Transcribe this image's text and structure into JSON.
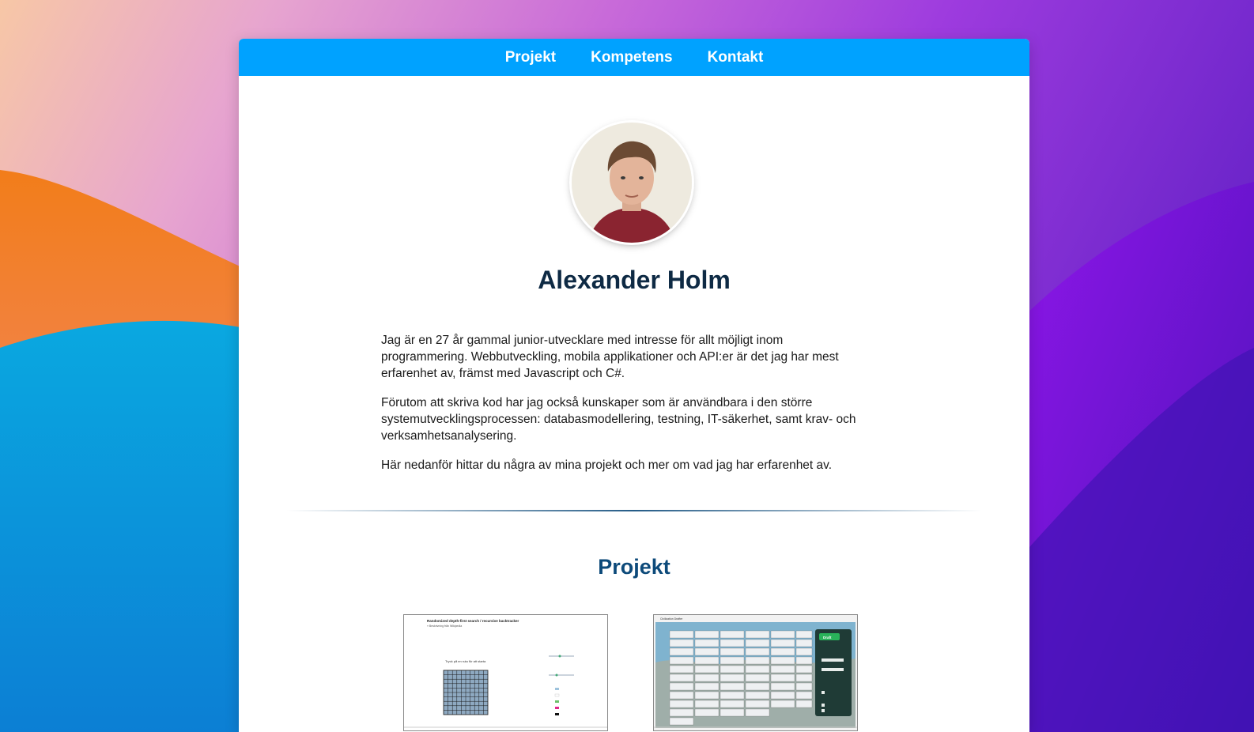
{
  "nav": {
    "items": [
      {
        "label": "Projekt"
      },
      {
        "label": "Kompetens"
      },
      {
        "label": "Kontakt"
      }
    ]
  },
  "profile": {
    "name": "Alexander Holm",
    "paragraphs": [
      "Jag är en 27 år gammal junior-utvecklare med intresse för allt möjligt inom programmering. Webbutveckling, mobila applikationer och API:er är det jag har mest erfarenhet av, främst med Javascript och C#.",
      "Förutom att skriva kod har jag också kunskaper som är användbara i den större systemutvecklingsprocessen: databasmodellering, testning, IT-säkerhet, samt krav- och verksamhetsanalysering.",
      "Här nedanför hittar du några av mina projekt och mer om vad jag har erfarenhet av."
    ]
  },
  "projects": {
    "title": "Projekt",
    "thumb1": {
      "title": "Randomized depth-first search / recursive backtracker",
      "subtitle": "» Beskrivning från Wikipedia",
      "prompt": "Tryck på en ruta för att starta"
    },
    "thumb2": {
      "window_title": "Civilization Drafter",
      "button": "Draft"
    }
  },
  "colors": {
    "nav": "#00a2ff",
    "name": "#0e2a44",
    "section_title": "#0d4a7a"
  }
}
